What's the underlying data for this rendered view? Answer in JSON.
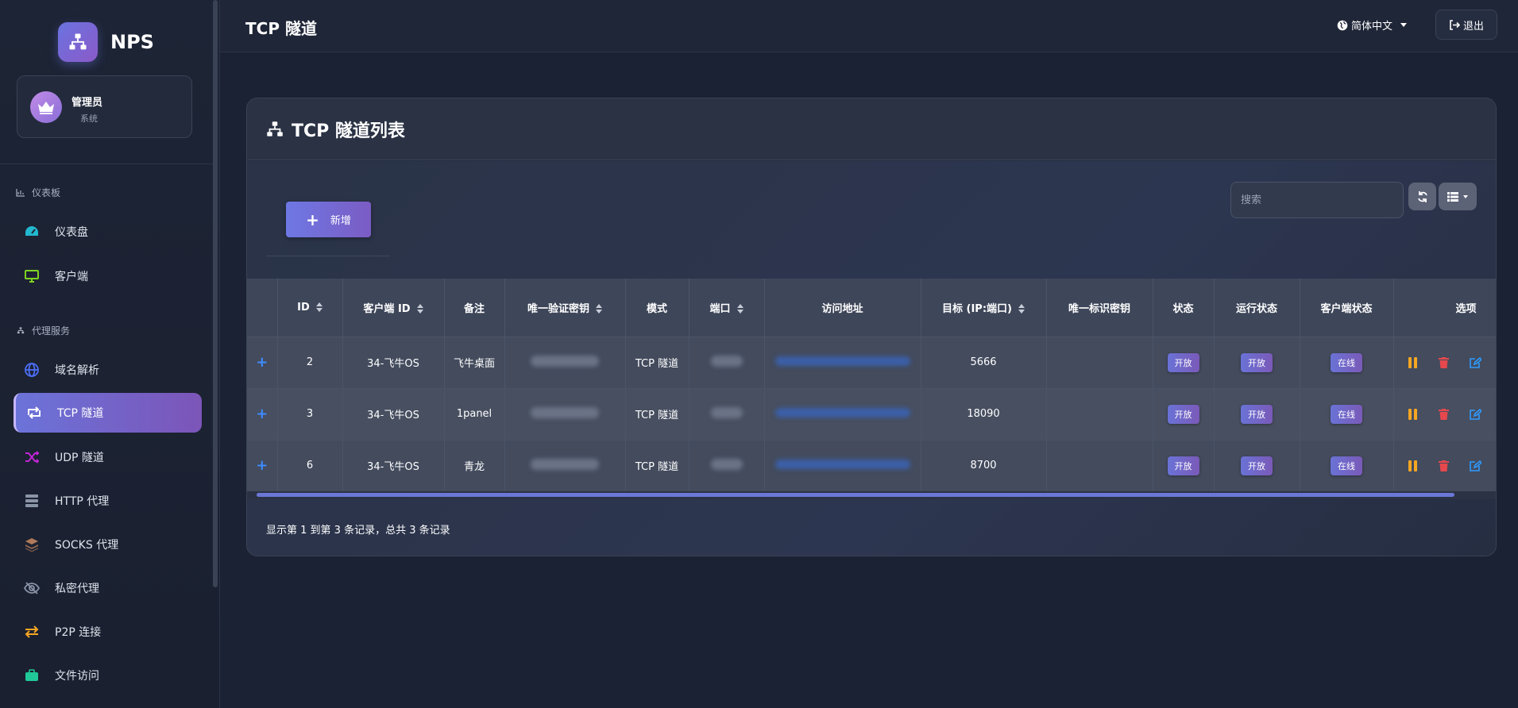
{
  "brand": {
    "name": "NPS"
  },
  "user": {
    "name": "管理员",
    "role": "系统"
  },
  "sidebar": {
    "sections": [
      {
        "title": "仪表板",
        "icon": "chart-icon"
      },
      {
        "title": "代理服务",
        "icon": "sitemap-icon"
      }
    ],
    "items": [
      {
        "label": "仪表盘",
        "icon": "dashboard-icon",
        "color": "#22b8cf"
      },
      {
        "label": "客户端",
        "icon": "monitor-icon",
        "color": "#7ed321"
      },
      {
        "label": "域名解析",
        "icon": "globe-icon",
        "color": "#4c6ef5"
      },
      {
        "label": "TCP 隧道",
        "icon": "retweet-icon",
        "color": "#ffffff",
        "active": true
      },
      {
        "label": "UDP 隧道",
        "icon": "shuffle-icon",
        "color": "#c026d3"
      },
      {
        "label": "HTTP 代理",
        "icon": "server-icon",
        "color": "#8a94a8"
      },
      {
        "label": "SOCKS 代理",
        "icon": "layers-icon",
        "color": "#b07a5a"
      },
      {
        "label": "私密代理",
        "icon": "eye-slash-icon",
        "color": "#8a94a8"
      },
      {
        "label": "P2P 连接",
        "icon": "exchange-icon",
        "color": "#f5a623"
      },
      {
        "label": "文件访问",
        "icon": "briefcase-icon",
        "color": "#20c997"
      }
    ]
  },
  "header": {
    "title": "TCP 隧道",
    "language": "简体中文",
    "logout_label": "退出"
  },
  "card": {
    "title": "TCP 隧道列表",
    "add_label": "新增",
    "search_placeholder": "搜索"
  },
  "table": {
    "columns": [
      {
        "label": "",
        "sortable": false
      },
      {
        "label": "ID",
        "sortable": true
      },
      {
        "label": "客户端 ID",
        "sortable": true
      },
      {
        "label": "备注",
        "sortable": false
      },
      {
        "label": "唯一验证密钥",
        "sortable": true
      },
      {
        "label": "模式",
        "sortable": false
      },
      {
        "label": "端口",
        "sortable": true
      },
      {
        "label": "访问地址",
        "sortable": false
      },
      {
        "label": "目标 (IP:端口)",
        "sortable": true
      },
      {
        "label": "唯一标识密钥",
        "sortable": false
      },
      {
        "label": "状态",
        "sortable": false
      },
      {
        "label": "运行状态",
        "sortable": false
      },
      {
        "label": "客户端状态",
        "sortable": false
      },
      {
        "label": "选项",
        "sortable": false
      }
    ],
    "rows": [
      {
        "id": "2",
        "client": "34-飞牛OS",
        "remark": "飞牛桌面",
        "mode": "TCP 隧道",
        "target": "5666",
        "status": "开放",
        "run_status": "开放",
        "client_status": "在线"
      },
      {
        "id": "3",
        "client": "34-飞牛OS",
        "remark": "1panel",
        "mode": "TCP 隧道",
        "target": "18090",
        "status": "开放",
        "run_status": "开放",
        "client_status": "在线"
      },
      {
        "id": "6",
        "client": "34-飞牛OS",
        "remark": "青龙",
        "mode": "TCP 隧道",
        "target": "8700",
        "status": "开放",
        "run_status": "开放",
        "client_status": "在线"
      }
    ]
  },
  "footer": {
    "summary": "显示第 1 到第 3 条记录，总共 3 条记录"
  },
  "colors": {
    "accent_start": "#6e78e4",
    "accent_end": "#7b5cc4",
    "pause": "#f5a623",
    "delete": "#e5484d",
    "edit": "#2f9bff"
  }
}
